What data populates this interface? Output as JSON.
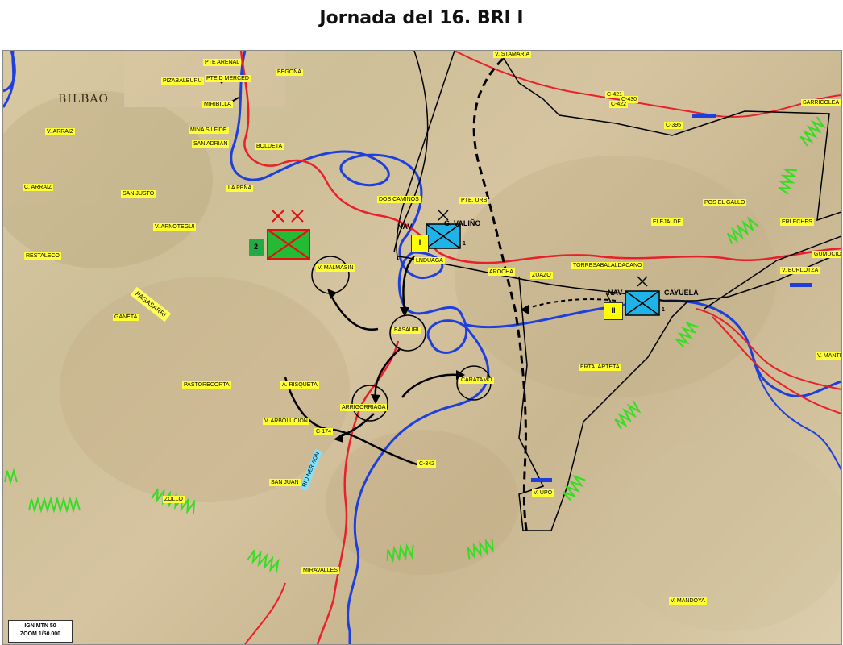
{
  "title": "Jornada del 16. BRI I",
  "scale_box": {
    "line1": "IGN MTN 50",
    "line2": "ZOOM 1/50.000"
  },
  "map_print": {
    "bilbao": "BILBAO"
  },
  "units": {
    "nav_left": "NAV",
    "nav_left_name": "G. VALIÑO",
    "nav_left_bn": "I",
    "nav_left_sub": "1",
    "nav_right": "NAV",
    "nav_right_name": "CAYUELA",
    "nav_right_bn": "II",
    "nav_right_sub": "1",
    "enemy_flag": "2"
  },
  "place_labels": {
    "pte_arenal": "PTE ARENAL",
    "pte_merced": "PTE D MERCED",
    "pizabalburu": "PIZABALBURU",
    "miribilla": "MIRIBILLA",
    "begona": "BEGOÑA",
    "mina_silfide": "MINA SILFIDE",
    "san_adrian": "SAN ADRIAN",
    "v_arraiz": "V. ARRAIZ",
    "bolueta": "BOLUETA",
    "la_pena": "LA PEÑA",
    "c_arraiz": "C. ARRAIZ",
    "san_justo": "SAN JUSTO",
    "v_arnotegui": "V. ARNOTEGUI",
    "restaleco": "RESTALECO",
    "ganeta": "GANETA",
    "dos_caminos": "DOS CAMINOS",
    "pte_urb": "PTE. URB",
    "v_malmasin": "V. MALMASIN",
    "lnduagai": "LNDUAGA",
    "arocha": "AROCHA",
    "zuazo": "ZUAZO",
    "basauri": "BASAURI",
    "torresabalaldacano": "TORRESABALALDACANO",
    "caratamo": "CARATAMO",
    "erta_arteta": "ERTA. ARTETA",
    "pastorecorta": "PASTORECORTA",
    "a_risqueta": "A. RISQUETA",
    "arrigorriaga": "ARRIGORRIAGA",
    "v_arbolucion": "V. ARBOLUCION",
    "c174": "C-174",
    "c342": "C-342",
    "san_juan": "SAN JUAN",
    "zollo": "ZOLLO",
    "v_upo": "V. UPO",
    "miravalles": "MIRAVALLES",
    "v_mandoya": "V. MANDOYA",
    "c421": "C-421",
    "c430": "C-430",
    "c422": "C-422",
    "c395": "C-395",
    "v_stamaria": "V. STAMARIA",
    "sarricolea": "SARRICOLEA",
    "pos_el_gallo": "POS EL GALLO",
    "elejalde": "ELEJALDE",
    "erlecheś": "ERLECHES",
    "gumucio": "GUMUCIO",
    "v_burlotza": "V. BURLOTZA",
    "v_mantil": "V. MANTIL"
  },
  "river_label": "RIO NERVION",
  "pagasa_label": "PAGASARRI",
  "colors": {
    "road_red": "#e8202a",
    "river_blue": "#1f3fdc",
    "front_black": "#000000",
    "entrench_green": "#33dd22",
    "nationalist_blue": "#1fb4e8",
    "enemy_green": "#22bb33",
    "label_yellow": "#ffff33"
  },
  "icons": [
    "cross-mark-icon",
    "trench-symbol-icon",
    "unit-symbol-icon"
  ]
}
